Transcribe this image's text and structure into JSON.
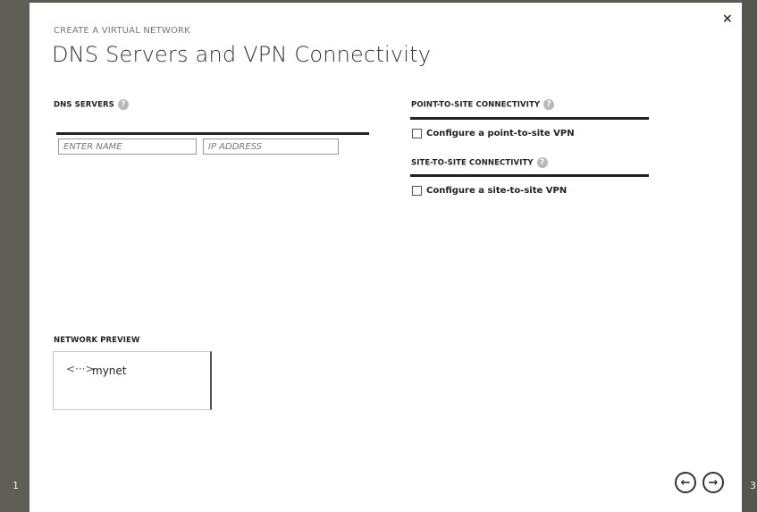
{
  "wizard": {
    "breadcrumb": "CREATE A VIRTUAL NETWORK",
    "title": "DNS Servers and VPN Connectivity",
    "close_icon": "×",
    "step_prev": "1",
    "step_next": "3"
  },
  "dns": {
    "label": "DNS SERVERS",
    "help_icon": "?",
    "name_placeholder": "ENTER NAME",
    "ip_placeholder": "IP ADDRESS"
  },
  "p2s": {
    "label": "POINT-TO-SITE CONNECTIVITY",
    "help_icon": "?",
    "checkbox_label": "Configure a point-to-site VPN",
    "checked": false
  },
  "s2s": {
    "label": "SITE-TO-SITE CONNECTIVITY",
    "help_icon": "?",
    "checkbox_label": "Configure a site-to-site VPN",
    "checked": false
  },
  "preview": {
    "label": "NETWORK PREVIEW",
    "network_icon": "<···>",
    "network_name": "mynet"
  },
  "nav": {
    "back_icon": "←",
    "next_icon": "→"
  }
}
